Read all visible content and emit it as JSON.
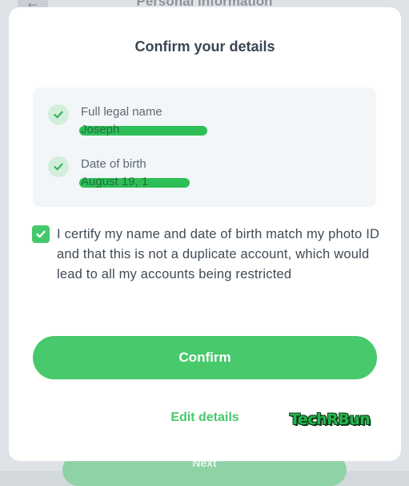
{
  "background": {
    "title": "Personal Information",
    "back_icon": "arrow-left-icon",
    "bottom_button_label": "Next"
  },
  "modal": {
    "title": "Confirm your details",
    "details": [
      {
        "label": "Full legal name",
        "value": "Joseph",
        "redacted": true,
        "icon": "check-icon"
      },
      {
        "label": "Date of birth",
        "value": "August 19, 1",
        "redacted": true,
        "icon": "check-icon"
      }
    ],
    "certify": {
      "checked": true,
      "text": "I certify my name and date of birth match my photo ID and that this is not a duplicate account, which would lead to all my accounts being restricted"
    },
    "confirm_label": "Confirm",
    "edit_label": "Edit details"
  },
  "watermark": "TechRBun",
  "colors": {
    "accent": "#47c96c",
    "check_bg": "#d3efdc",
    "card_bg": "#f3f6f9",
    "redaction": "#2dbf55"
  }
}
